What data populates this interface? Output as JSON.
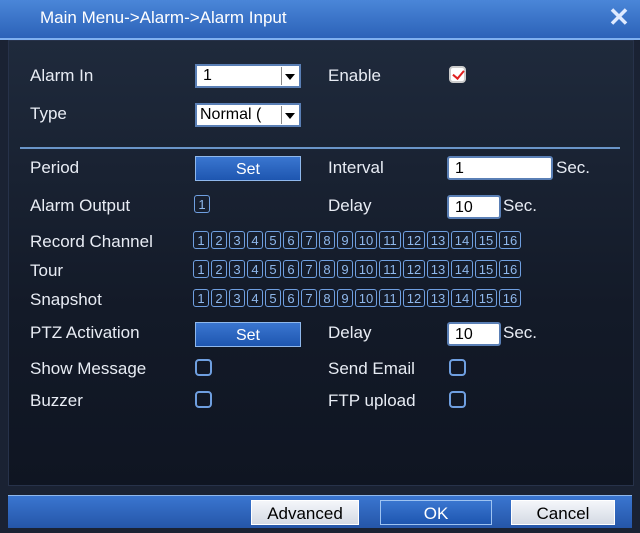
{
  "window": {
    "title": "Main Menu->Alarm->Alarm Input",
    "close_glyph": "✕"
  },
  "labels": {
    "alarm_in": "Alarm In",
    "enable": "Enable",
    "type": "Type",
    "period": "Period",
    "interval": "Interval",
    "sec": "Sec.",
    "alarm_output": "Alarm Output",
    "delay": "Delay",
    "record_channel": "Record Channel",
    "tour": "Tour",
    "snapshot": "Snapshot",
    "ptz_activation": "PTZ Activation",
    "show_message": "Show Message",
    "send_email": "Send Email",
    "buzzer": "Buzzer",
    "ftp_upload": "FTP upload"
  },
  "values": {
    "alarm_in": "1",
    "type": "Normal (",
    "interval": "1",
    "delay_output": "10",
    "delay_ptz": "10",
    "alarm_output_channel": "1"
  },
  "states": {
    "enable": true,
    "show_message": false,
    "send_email": false,
    "buzzer": false,
    "ftp_upload": false
  },
  "buttons": {
    "period_set": "Set",
    "ptz_set": "Set",
    "advanced": "Advanced",
    "ok": "OK",
    "cancel": "Cancel"
  },
  "channels": [
    "1",
    "2",
    "3",
    "4",
    "5",
    "6",
    "7",
    "8",
    "9",
    "10",
    "11",
    "12",
    "13",
    "14",
    "15",
    "16"
  ]
}
